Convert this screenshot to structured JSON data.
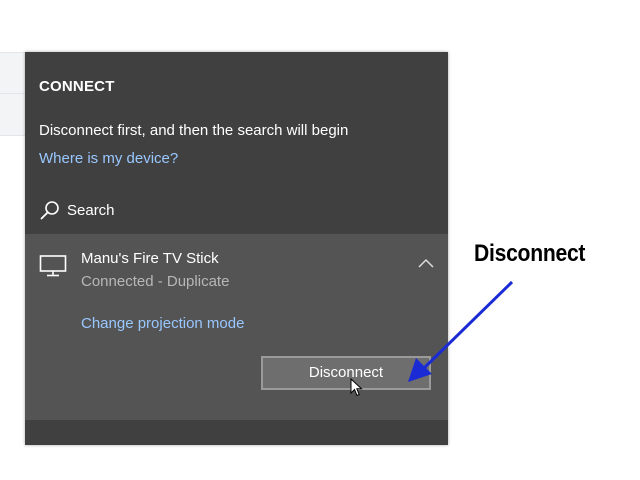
{
  "panel": {
    "title": "CONNECT",
    "message": "Disconnect first, and then the search will begin",
    "help_link": "Where is my device?",
    "search_label": "Search",
    "search_icon": "search-icon"
  },
  "device": {
    "icon": "monitor-icon",
    "name": "Manu's Fire TV Stick",
    "status": "Connected - Duplicate",
    "projection_link": "Change projection mode",
    "disconnect_label": "Disconnect",
    "collapse_icon": "chevron-up-icon"
  },
  "annotation": {
    "label": "Disconnect",
    "arrow_color": "#1a2bd6"
  },
  "colors": {
    "panel_bg": "#404040",
    "card_bg": "#545454",
    "link": "#99c7ff",
    "status_text": "#b7b7b7"
  }
}
